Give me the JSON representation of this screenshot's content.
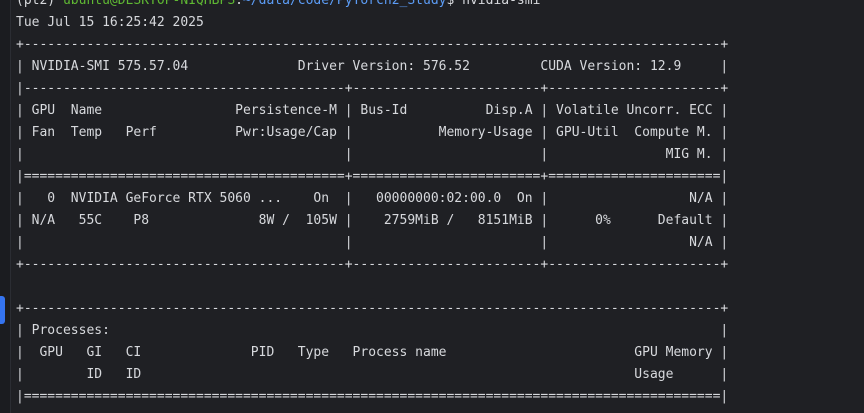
{
  "prompt": {
    "env": "(pt2) ",
    "user_host": "ubuntu@DESKTOP-NIQHBPS",
    "colon": ":",
    "path": "~/data/code/PyTorch2_Study",
    "symbol": "$ ",
    "command": "nvidia-smi"
  },
  "lines": [
    "Tue Jul 15 16:25:42 2025",
    "+-----------------------------------------------------------------------------------------+",
    "| NVIDIA-SMI 575.57.04              Driver Version: 576.52         CUDA Version: 12.9     |",
    "|-----------------------------------------+------------------------+----------------------+",
    "| GPU  Name                 Persistence-M | Bus-Id          Disp.A | Volatile Uncorr. ECC |",
    "| Fan  Temp   Perf          Pwr:Usage/Cap |           Memory-Usage | GPU-Util  Compute M. |",
    "|                                         |                        |               MIG M. |",
    "|=========================================+========================+======================|",
    "|   0  NVIDIA GeForce RTX 5060 ...    On  |   00000000:02:00.0  On |                  N/A |",
    "| N/A   55C    P8              8W /  105W |    2759MiB /   8151MiB |      0%      Default |",
    "|                                         |                        |                  N/A |",
    "+-----------------------------------------+------------------------+----------------------+",
    "",
    "+-----------------------------------------------------------------------------------------+",
    "| Processes:                                                                              |",
    "|  GPU   GI   CI              PID   Type   Process name                        GPU Memory |",
    "|        ID   ID                                                               Usage      |",
    "|=========================================================================================|"
  ]
}
